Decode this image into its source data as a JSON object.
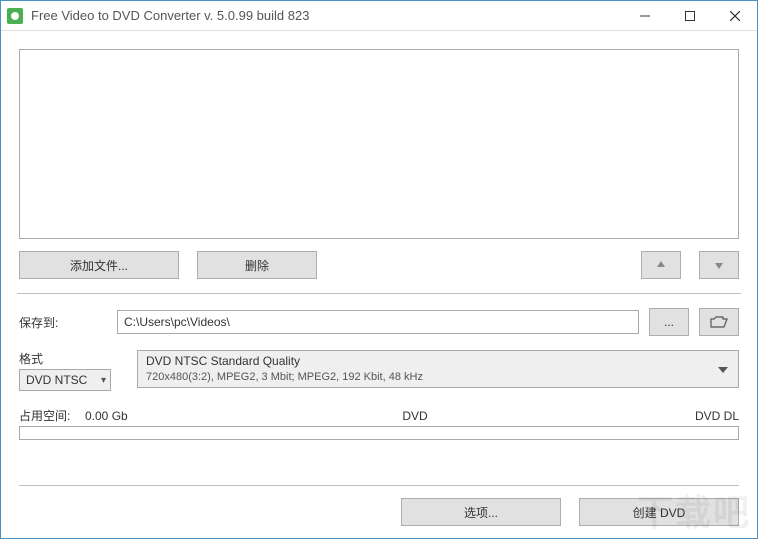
{
  "window": {
    "title": "Free Video to DVD Converter  v. 5.0.99 build 823"
  },
  "toolbar": {
    "add_files": "添加文件...",
    "delete": "删除"
  },
  "save": {
    "label": "保存到:",
    "path": "C:\\Users\\pc\\Videos\\",
    "browse": "..."
  },
  "format": {
    "label": "格式",
    "selected": "DVD NTSC",
    "quality_line1": "DVD NTSC Standard Quality",
    "quality_line2": "720x480(3:2), MPEG2, 3 Mbit; MPEG2, 192 Kbit, 48 kHz"
  },
  "space": {
    "label": "占用空间:",
    "value": "0.00 Gb",
    "marker_mid": "DVD",
    "marker_right": "DVD DL"
  },
  "actions": {
    "options": "选项...",
    "create": "创建 DVD"
  },
  "watermark": "下载吧"
}
